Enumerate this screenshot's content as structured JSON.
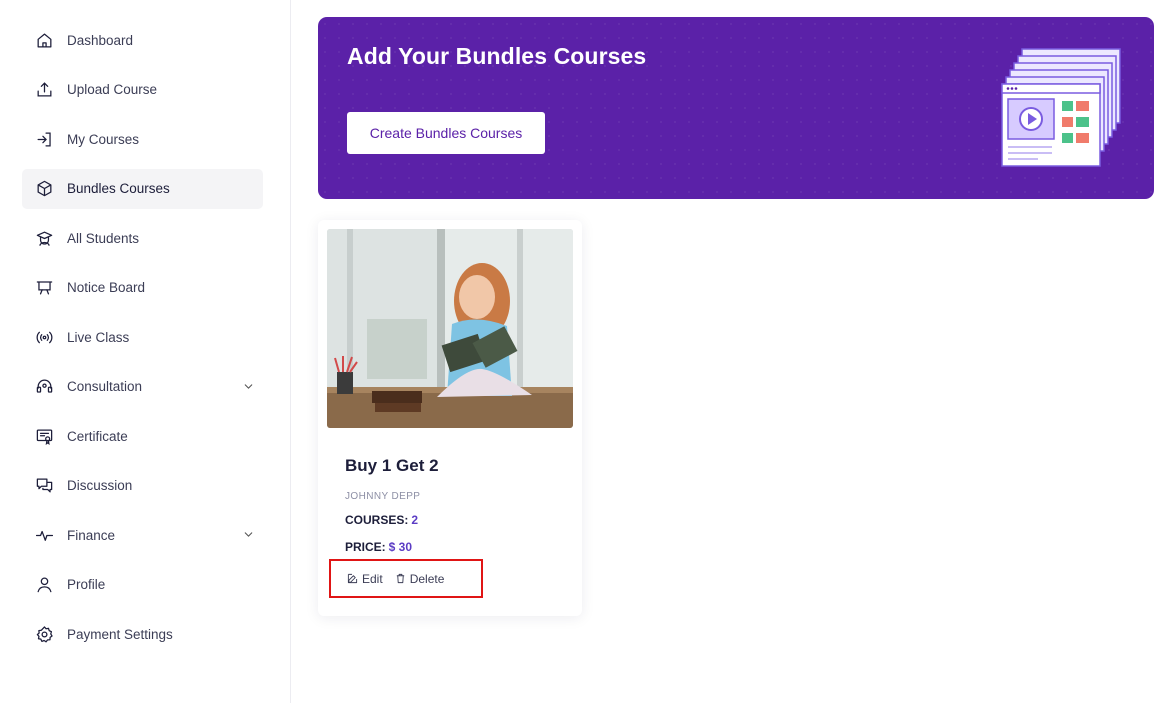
{
  "sidebar": {
    "items": [
      {
        "label": "Dashboard",
        "icon": "home-icon"
      },
      {
        "label": "Upload Course",
        "icon": "upload-icon"
      },
      {
        "label": "My Courses",
        "icon": "login-arrow-icon"
      },
      {
        "label": "Bundles Courses",
        "icon": "box-icon",
        "active": true
      },
      {
        "label": "All Students",
        "icon": "student-icon"
      },
      {
        "label": "Notice Board",
        "icon": "board-icon"
      },
      {
        "label": "Live Class",
        "icon": "broadcast-icon"
      },
      {
        "label": "Consultation",
        "icon": "headset-icon",
        "expandable": true
      },
      {
        "label": "Certificate",
        "icon": "certificate-icon"
      },
      {
        "label": "Discussion",
        "icon": "chat-icon"
      },
      {
        "label": "Finance",
        "icon": "pulse-icon",
        "expandable": true
      },
      {
        "label": "Profile",
        "icon": "user-icon"
      },
      {
        "label": "Payment Settings",
        "icon": "gear-icon"
      }
    ]
  },
  "banner": {
    "title": "Add Your Bundles Courses",
    "button_label": "Create Bundles Courses",
    "color": "#5b21a8"
  },
  "card": {
    "title": "Buy 1 Get 2",
    "author": "JOHNNY DEPP",
    "courses_label": "COURSES:",
    "courses_value": "2",
    "price_label": "PRICE:",
    "price_value": "$ 30",
    "edit_label": "Edit",
    "delete_label": "Delete"
  },
  "colors": {
    "accent": "#5b21a8",
    "highlight_box": "#e01515"
  }
}
